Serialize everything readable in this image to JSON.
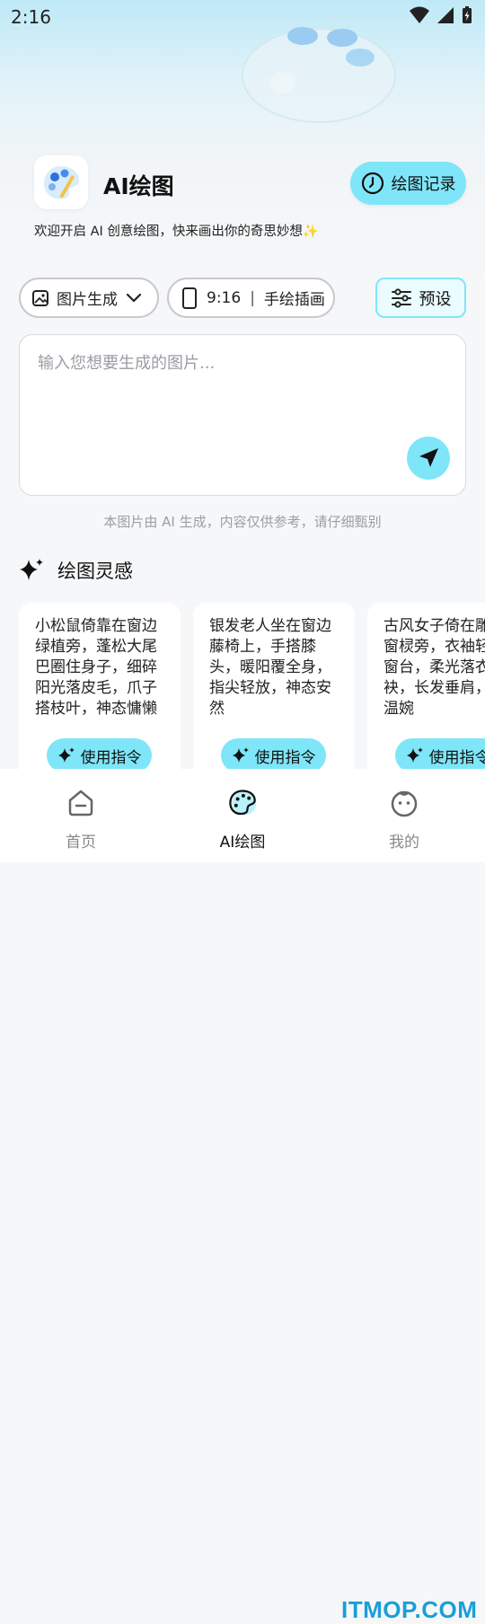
{
  "status": {
    "time": "2:16"
  },
  "header": {
    "title": "AI绘图",
    "history_label": "绘图记录"
  },
  "welcome": {
    "text": "欢迎开启 AI 创意绘图，快来画出你的奇思妙想✨"
  },
  "options": {
    "mode_label": "图片生成",
    "ratio_label": "9:16",
    "separator": "|",
    "style_label": "手绘插画",
    "preset_label": "预设"
  },
  "prompt": {
    "placeholder": "输入您想要生成的图片..."
  },
  "disclaimer": "本图片由 AI 生成，内容仅供参考，请仔细甄别",
  "inspiration": {
    "title": "绘图灵感",
    "cards": [
      {
        "text": "小松鼠倚靠在窗边绿植旁，蓬松大尾巴圈住身子，细碎阳光落皮毛，爪子搭枝叶，神态慵懒",
        "button": "使用指令"
      },
      {
        "text": "银发老人坐在窗边藤椅上，手搭膝头，暖阳覆全身，指尖轻放，神态安然",
        "button": "使用指令"
      },
      {
        "text": "古风女子倚在雕花窗棂旁，衣袖轻搭窗台，柔光落衣袂，长发垂肩，神温婉",
        "button": "使用指令"
      }
    ]
  },
  "nav": {
    "items": [
      {
        "label": "首页"
      },
      {
        "label": "AI绘图"
      },
      {
        "label": "我的"
      }
    ]
  },
  "watermark": "ITMOP.COM",
  "colors": {
    "accent": "#7ee6f8",
    "brand_watermark": "#1a9fd8"
  }
}
